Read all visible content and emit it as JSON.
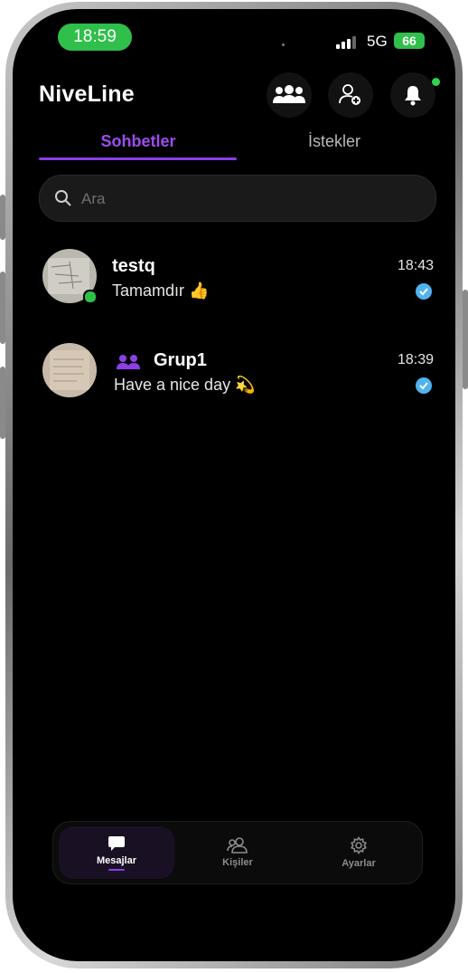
{
  "status_bar": {
    "time": "18:59",
    "network": "5G",
    "battery": "66"
  },
  "header": {
    "title": "NiveLine"
  },
  "tabs": [
    {
      "label": "Sohbetler"
    },
    {
      "label": "İstekler"
    }
  ],
  "search": {
    "placeholder": "Ara"
  },
  "chats": [
    {
      "name": "testq",
      "message": "Tamamdır 👍",
      "time": "18:43"
    },
    {
      "name": "Grup1",
      "message": "Have a nice day 💫",
      "time": "18:39"
    }
  ],
  "bottom_nav": [
    {
      "label": "Mesajlar"
    },
    {
      "label": "Kişiler"
    },
    {
      "label": "Ayarlar"
    }
  ],
  "colors": {
    "accent": "#8a3ee8",
    "online": "#2fbf4a",
    "read_check": "#4fb3f0"
  }
}
